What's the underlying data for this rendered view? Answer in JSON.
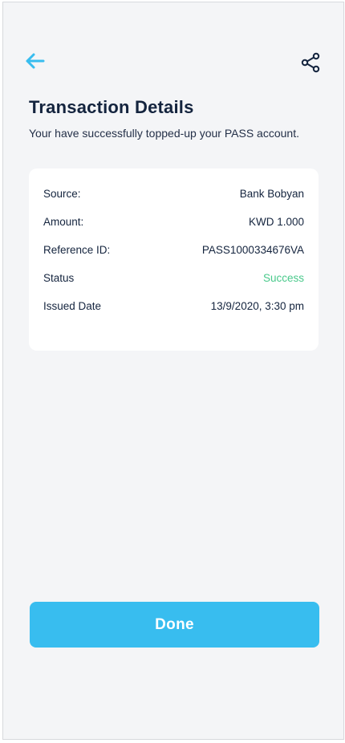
{
  "header": {
    "back_icon": "arrow-left-icon",
    "share_icon": "share-icon",
    "accent_color": "#38bdef"
  },
  "page": {
    "title": "Transaction Details",
    "subtitle": "Your have successfully topped-up your PASS account."
  },
  "details": {
    "rows": [
      {
        "label": "Source:",
        "value": "Bank Bobyan"
      },
      {
        "label": "Amount:",
        "value": "KWD 1.000"
      },
      {
        "label": "Reference ID:",
        "value": "PASS1000334676VA"
      },
      {
        "label": "Status",
        "value": "Success",
        "value_color": "#49c98b"
      },
      {
        "label": "Issued Date",
        "value": "13/9/2020, 3:30 pm"
      }
    ]
  },
  "actions": {
    "done_label": "Done"
  }
}
